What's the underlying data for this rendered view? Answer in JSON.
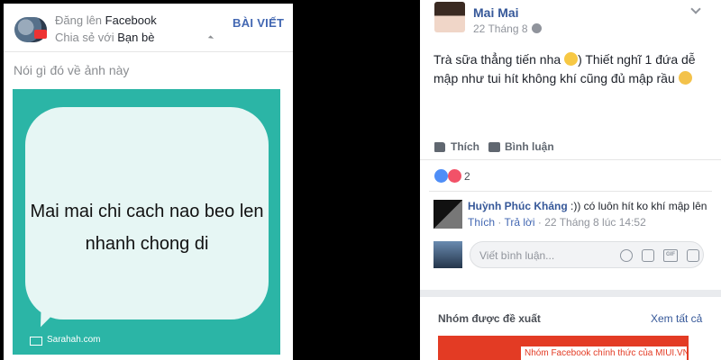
{
  "left": {
    "share_prefix": "Đăng lên ",
    "share_target": "Facebook",
    "audience_prefix": "Chia sẻ với ",
    "audience_value": "Bạn bè",
    "post_button": "BÀI VIẾT",
    "caption_placeholder": "Nói gì đó về ảnh này",
    "card": {
      "message_line1": "Mai mai chi cach nao beo len",
      "message_line2": "nhanh chong di",
      "watermark": "Sarahah.com",
      "bg_color": "#2bb5a6"
    }
  },
  "right": {
    "author": "Mai Mai",
    "date": "22 Tháng 8 · ",
    "post_text_part1": "Trà sữa thẳng tiến nha ",
    "post_text_part2": ") Thiết nghĩ 1 đứa dễ mập như tui hít không khí cũng đủ mập rầu ",
    "like_label": "Thích",
    "comment_label": "Bình luận",
    "reaction_count": "2",
    "comment": {
      "author": "Huỳnh Phúc Kháng",
      "text": " :)) có luôn hít ko khí mập lên",
      "like": "Thích",
      "sep": " · ",
      "reply": "Trả lời",
      "time": " · 22 Tháng 8 lúc 14:52"
    },
    "reply_placeholder": "Viết bình luận...",
    "gif_label": "GIF",
    "groups_title": "Nhóm được đề xuất",
    "see_all": "Xem tất cả",
    "group_label": "Nhóm Facebook chính thức của MIUI.VN",
    "accent": "#4267b2",
    "link_color": "#365899"
  }
}
